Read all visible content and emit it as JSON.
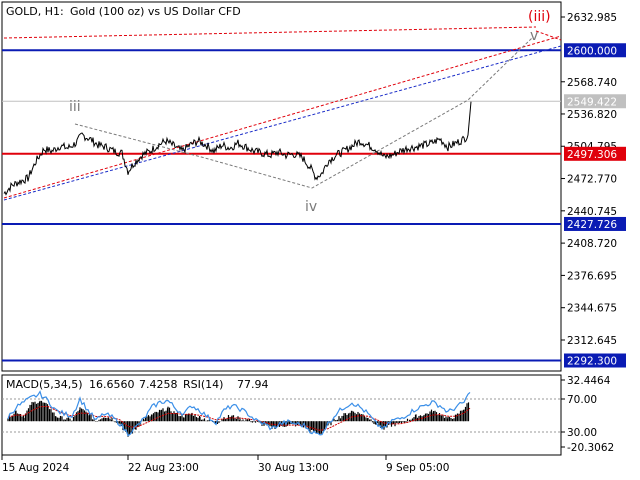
{
  "window": {
    "symbol_label": "GOLD, H1:",
    "description": "Gold (100 oz) vs US Dollar CFD"
  },
  "colors": {
    "background": "#ffffff",
    "axis": "#000000",
    "price_line": "#000000",
    "level_blue": "#0a1bb4",
    "level_red": "#e0000b",
    "trend_red": "#e0000b",
    "trend_blue": "#1a2cc8",
    "trend_gray": "#7a7a7a",
    "current_price_badge": "#c0c0c0",
    "macd_hist": "#000000",
    "macd_signal": "#d00000",
    "rsi": "#3b8fe8"
  },
  "chart_data": [
    {
      "type": "line",
      "ylim": [
        2280,
        2650
      ],
      "price_ticks": [
        "2632.985",
        "2600.000",
        "2568.740",
        "2549.422",
        "2536.820",
        "2504.795",
        "2497.306",
        "2472.770",
        "2440.745",
        "2427.726",
        "2408.720",
        "2376.695",
        "2344.675",
        "2312.645",
        "2292.300"
      ],
      "x_labels": [
        "15 Aug 2024",
        "22 Aug 23:00",
        "30 Aug 13:00",
        "9 Sep 05:00"
      ],
      "current_price": "2549.422",
      "levels": [
        {
          "price": 2600.0,
          "label": "2600.000",
          "color": "blue"
        },
        {
          "price": 2497.306,
          "label": "2497.306",
          "color": "red"
        },
        {
          "price": 2427.726,
          "label": "2427.726",
          "color": "blue"
        },
        {
          "price": 2292.3,
          "label": "2292.300",
          "color": "blue"
        }
      ],
      "wave_labels": [
        "iii",
        "iv",
        "v",
        "(iii)"
      ],
      "close_path": [
        [
          0,
          2458
        ],
        [
          8,
          2466
        ],
        [
          16,
          2470
        ],
        [
          24,
          2473
        ],
        [
          32,
          2490
        ],
        [
          40,
          2502
        ],
        [
          48,
          2500
        ],
        [
          56,
          2505
        ],
        [
          64,
          2503
        ],
        [
          72,
          2508
        ],
        [
          78,
          2516
        ],
        [
          86,
          2512
        ],
        [
          94,
          2506
        ],
        [
          102,
          2504
        ],
        [
          110,
          2500
        ],
        [
          118,
          2498
        ],
        [
          124,
          2480
        ],
        [
          130,
          2488
        ],
        [
          138,
          2496
        ],
        [
          146,
          2500
        ],
        [
          154,
          2506
        ],
        [
          162,
          2510
        ],
        [
          170,
          2505
        ],
        [
          178,
          2500
        ],
        [
          186,
          2506
        ],
        [
          194,
          2510
        ],
        [
          202,
          2506
        ],
        [
          210,
          2500
        ],
        [
          218,
          2506
        ],
        [
          226,
          2503
        ],
        [
          234,
          2508
        ],
        [
          242,
          2504
        ],
        [
          250,
          2500
        ],
        [
          258,
          2498
        ],
        [
          266,
          2496
        ],
        [
          274,
          2499
        ],
        [
          282,
          2496
        ],
        [
          290,
          2497
        ],
        [
          298,
          2494
        ],
        [
          306,
          2484
        ],
        [
          312,
          2474
        ],
        [
          318,
          2478
        ],
        [
          324,
          2490
        ],
        [
          332,
          2496
        ],
        [
          340,
          2500
        ],
        [
          348,
          2505
        ],
        [
          356,
          2510
        ],
        [
          364,
          2506
        ],
        [
          372,
          2502
        ],
        [
          380,
          2494
        ],
        [
          388,
          2496
        ],
        [
          396,
          2500
        ],
        [
          404,
          2503
        ],
        [
          412,
          2504
        ],
        [
          420,
          2506
        ],
        [
          428,
          2508
        ],
        [
          436,
          2512
        ],
        [
          444,
          2504
        ],
        [
          452,
          2508
        ],
        [
          460,
          2512
        ],
        [
          464,
          2516
        ],
        [
          467,
          2549
        ]
      ]
    },
    {
      "type": "line",
      "indicator_labels": [
        "MACD(5,34,5)",
        "16.6560",
        "7.4258",
        "RSI(14)",
        "77.94"
      ],
      "ticks": [
        "32.4464",
        "70.00",
        "30.00",
        "-20.3062"
      ],
      "macd_ylim": [
        -20.3062,
        32.4464
      ],
      "rsi_levels": [
        70,
        30
      ],
      "macd_hist": [
        [
          4,
          3
        ],
        [
          12,
          8
        ],
        [
          20,
          4
        ],
        [
          28,
          14
        ],
        [
          36,
          16
        ],
        [
          44,
          12
        ],
        [
          52,
          4
        ],
        [
          60,
          2
        ],
        [
          68,
          1
        ],
        [
          76,
          10
        ],
        [
          84,
          6
        ],
        [
          92,
          0
        ],
        [
          100,
          4
        ],
        [
          108,
          2
        ],
        [
          116,
          -2
        ],
        [
          124,
          -12
        ],
        [
          132,
          -6
        ],
        [
          140,
          2
        ],
        [
          148,
          5
        ],
        [
          156,
          8
        ],
        [
          164,
          10
        ],
        [
          172,
          6
        ],
        [
          180,
          4
        ],
        [
          188,
          6
        ],
        [
          196,
          3
        ],
        [
          204,
          1
        ],
        [
          212,
          -2
        ],
        [
          220,
          3
        ],
        [
          228,
          4
        ],
        [
          236,
          2
        ],
        [
          244,
          1
        ],
        [
          252,
          -1
        ],
        [
          260,
          -3
        ],
        [
          268,
          -5
        ],
        [
          276,
          -4
        ],
        [
          284,
          -3
        ],
        [
          292,
          -3
        ],
        [
          300,
          -4
        ],
        [
          308,
          -8
        ],
        [
          316,
          -10
        ],
        [
          324,
          -4
        ],
        [
          332,
          2
        ],
        [
          340,
          5
        ],
        [
          348,
          8
        ],
        [
          356,
          6
        ],
        [
          364,
          3
        ],
        [
          372,
          -2
        ],
        [
          380,
          -6
        ],
        [
          388,
          -3
        ],
        [
          396,
          -2
        ],
        [
          404,
          1
        ],
        [
          412,
          4
        ],
        [
          420,
          5
        ],
        [
          428,
          8
        ],
        [
          436,
          6
        ],
        [
          444,
          2
        ],
        [
          452,
          4
        ],
        [
          460,
          10
        ],
        [
          466,
          16
        ]
      ],
      "rsi": [
        [
          4,
          48
        ],
        [
          12,
          60
        ],
        [
          20,
          66
        ],
        [
          28,
          72
        ],
        [
          36,
          76
        ],
        [
          44,
          68
        ],
        [
          52,
          56
        ],
        [
          60,
          52
        ],
        [
          68,
          50
        ],
        [
          76,
          70
        ],
        [
          84,
          56
        ],
        [
          92,
          44
        ],
        [
          100,
          52
        ],
        [
          108,
          48
        ],
        [
          116,
          40
        ],
        [
          124,
          28
        ],
        [
          132,
          36
        ],
        [
          140,
          46
        ],
        [
          148,
          60
        ],
        [
          156,
          66
        ],
        [
          164,
          68
        ],
        [
          172,
          58
        ],
        [
          180,
          52
        ],
        [
          188,
          62
        ],
        [
          196,
          56
        ],
        [
          204,
          48
        ],
        [
          212,
          42
        ],
        [
          220,
          56
        ],
        [
          228,
          62
        ],
        [
          236,
          58
        ],
        [
          244,
          52
        ],
        [
          252,
          44
        ],
        [
          260,
          40
        ],
        [
          268,
          34
        ],
        [
          276,
          40
        ],
        [
          284,
          42
        ],
        [
          292,
          40
        ],
        [
          300,
          38
        ],
        [
          308,
          30
        ],
        [
          316,
          26
        ],
        [
          324,
          40
        ],
        [
          332,
          52
        ],
        [
          340,
          60
        ],
        [
          348,
          66
        ],
        [
          356,
          60
        ],
        [
          364,
          52
        ],
        [
          372,
          40
        ],
        [
          380,
          34
        ],
        [
          388,
          44
        ],
        [
          396,
          46
        ],
        [
          404,
          52
        ],
        [
          412,
          58
        ],
        [
          420,
          62
        ],
        [
          428,
          66
        ],
        [
          436,
          62
        ],
        [
          444,
          54
        ],
        [
          452,
          60
        ],
        [
          460,
          66
        ],
        [
          466,
          78
        ]
      ]
    }
  ]
}
